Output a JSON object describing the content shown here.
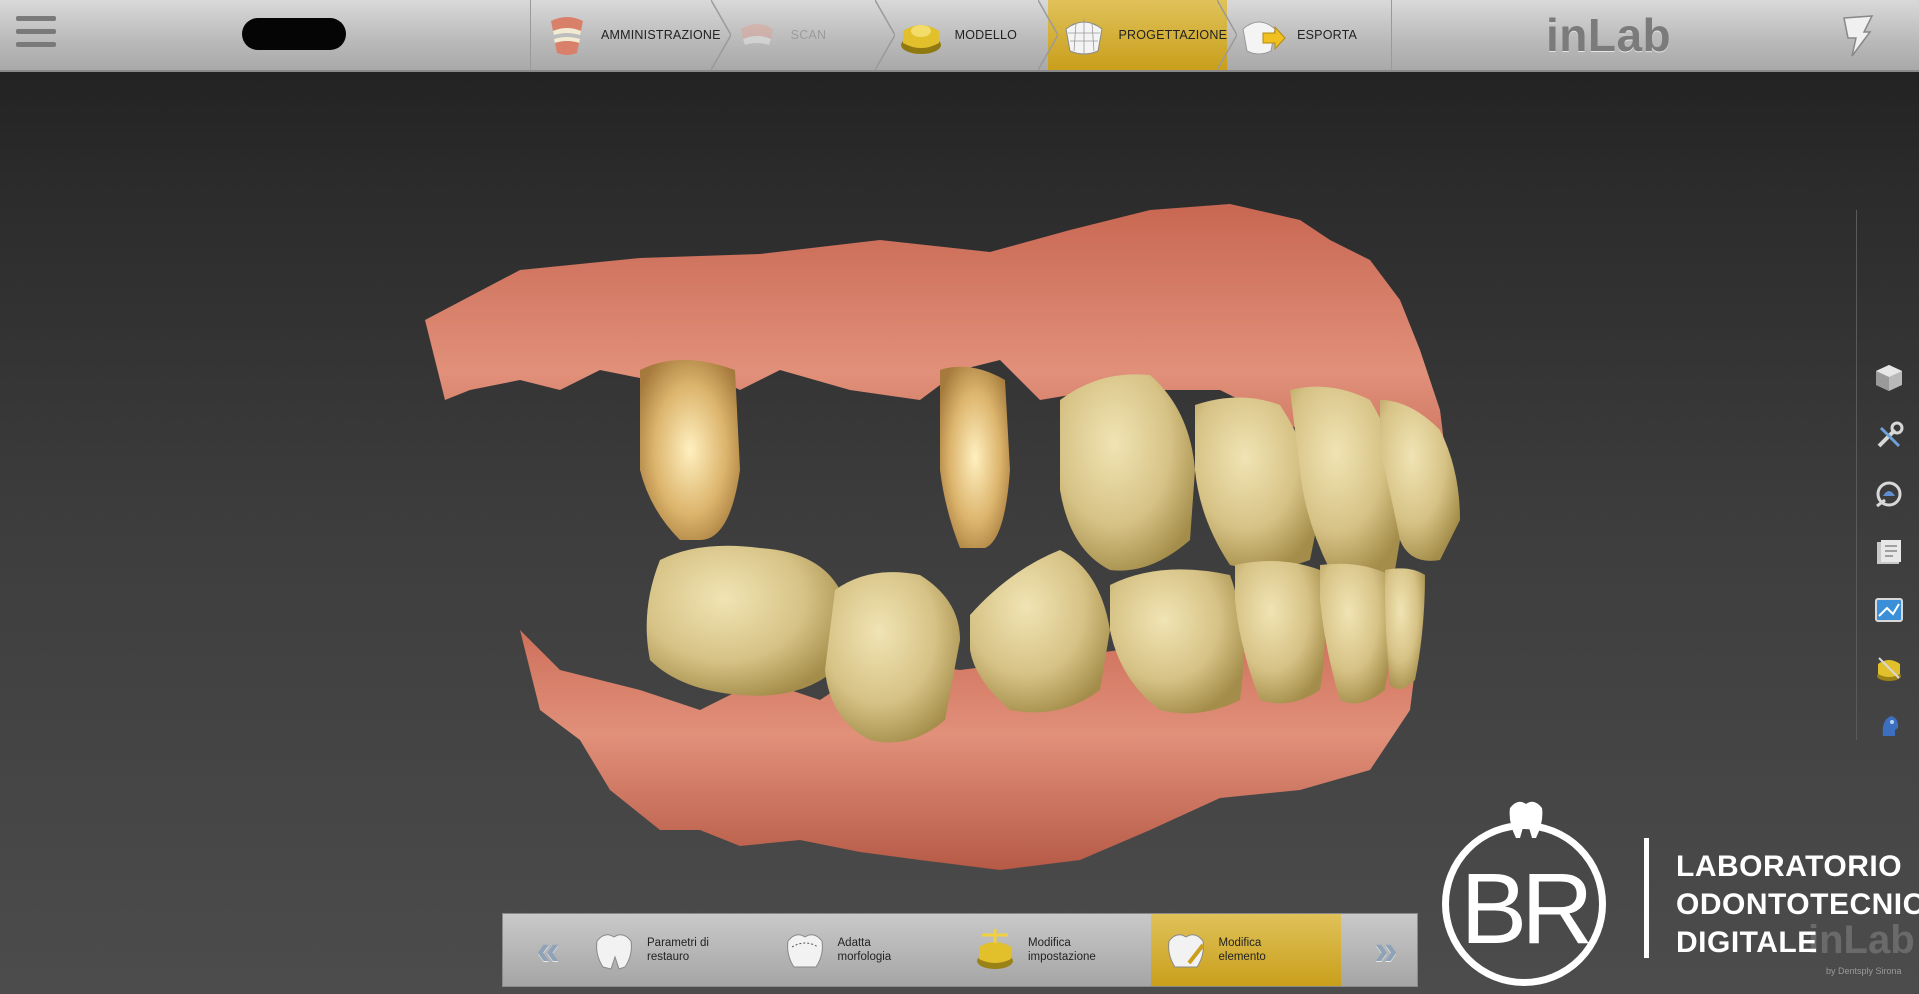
{
  "header": {
    "steps": [
      {
        "label": "AMMINISTRAZIONE",
        "icon": "jaw-icon",
        "state": "normal"
      },
      {
        "label": "SCAN",
        "icon": "scan-icon",
        "state": "disabled"
      },
      {
        "label": "MODELLO",
        "icon": "model-icon",
        "state": "normal"
      },
      {
        "label": "PROGETTAZIONE",
        "icon": "design-icon",
        "state": "active"
      },
      {
        "label": "ESPORTA",
        "icon": "export-icon",
        "state": "normal"
      }
    ],
    "app_name": "inLab"
  },
  "right_toolbar": {
    "icons": [
      "view-cube-icon",
      "tools-icon",
      "analysis-icon",
      "library-icon",
      "screenshot-icon",
      "model-tools-icon",
      "user-head-icon"
    ]
  },
  "bottom_bar": {
    "prev_label": "«",
    "next_label": "»",
    "steps": [
      {
        "label_line1": "Parametri di",
        "label_line2": "restauro",
        "icon": "tooth-params-icon",
        "state": "normal"
      },
      {
        "label_line1": "Adatta",
        "label_line2": "morfologia",
        "icon": "morphology-icon",
        "state": "normal"
      },
      {
        "label_line1": "Modifica",
        "label_line2": "impostazione",
        "icon": "edit-setup-icon",
        "state": "normal"
      },
      {
        "label_line1": "Modifica",
        "label_line2": "elemento",
        "icon": "edit-element-icon",
        "state": "active"
      }
    ]
  },
  "brand": {
    "monogram": "BR",
    "line1": "LABORATORIO",
    "line2": "ODONTOTECNICO",
    "line3": "DIGITALE"
  },
  "watermark": {
    "text": "inLab",
    "sub": "by Dentsply Sirona"
  },
  "colors": {
    "accent": "#d6b12f",
    "gum": "#d9826a",
    "tooth": "#d8c58a"
  }
}
